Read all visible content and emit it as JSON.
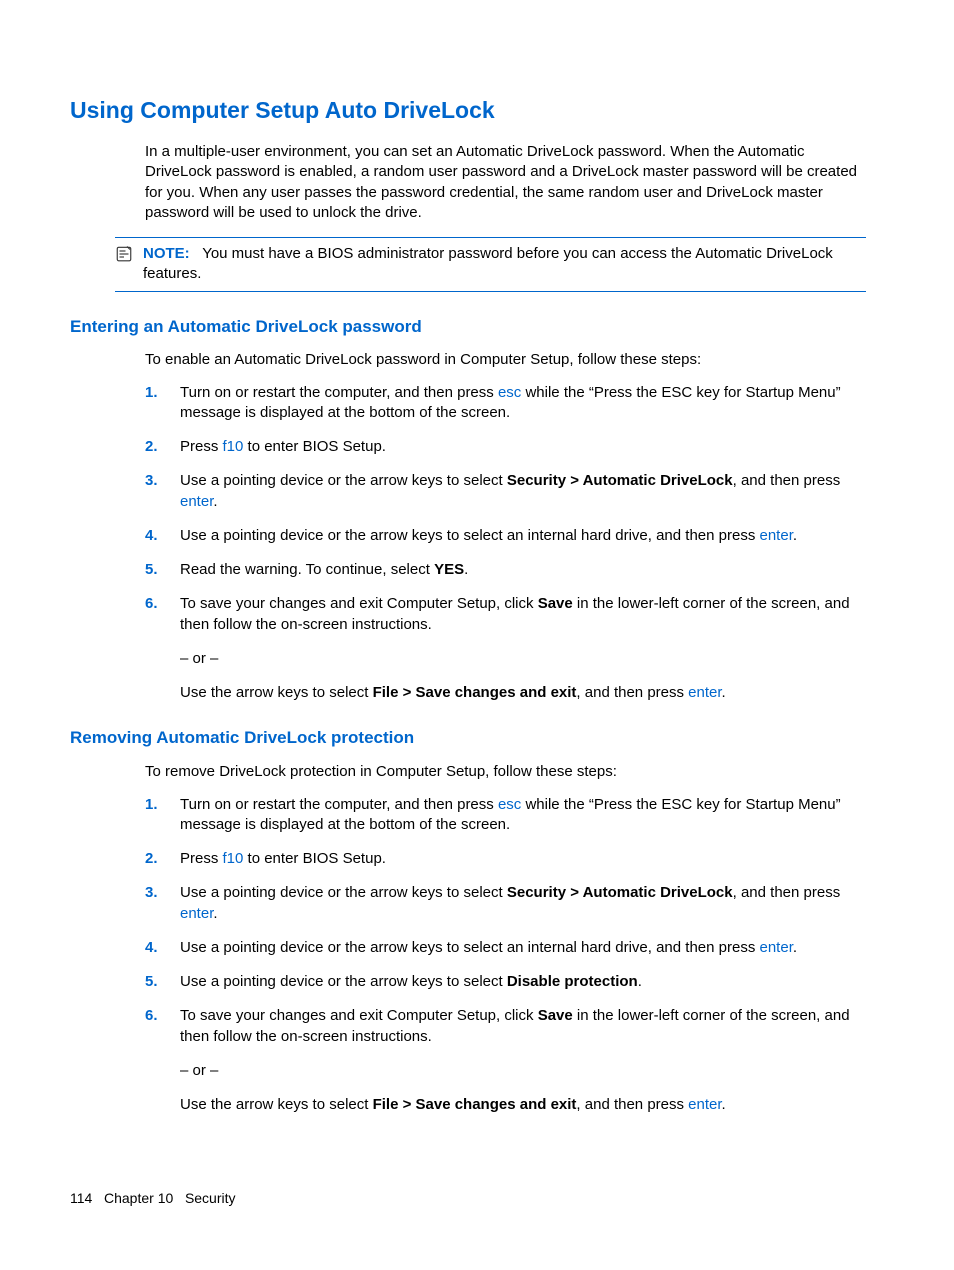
{
  "h1": "Using Computer Setup Auto DriveLock",
  "intro": "In a multiple-user environment, you can set an Automatic DriveLock password. When the Automatic DriveLock password is enabled, a random user password and a DriveLock master password will be created for you. When any user passes the password credential, the same random user and DriveLock master password will be used to unlock the drive.",
  "note": {
    "label": "NOTE:",
    "text": "You must have a BIOS administrator password before you can access the Automatic DriveLock features."
  },
  "sec1": {
    "title": "Entering an Automatic DriveLock password",
    "intro": "To enable an Automatic DriveLock password in Computer Setup, follow these steps:",
    "s1a": "Turn on or restart the computer, and then press ",
    "s1k": "esc",
    "s1b": " while the “Press the ESC key for Startup Menu” message is displayed at the bottom of the screen.",
    "s2a": "Press ",
    "s2k": "f10",
    "s2b": " to enter BIOS Setup.",
    "s3a": "Use a pointing device or the arrow keys to select ",
    "s3bold": "Security > Automatic DriveLock",
    "s3b": ", and then press ",
    "s3k": "enter",
    "s3c": ".",
    "s4a": "Use a pointing device or the arrow keys to select an internal hard drive, and then press ",
    "s4k": "enter",
    "s4b": ".",
    "s5a": "Read the warning. To continue, select ",
    "s5bold": "YES",
    "s5b": ".",
    "s6a": "To save your changes and exit Computer Setup, click ",
    "s6bold": "Save",
    "s6b": " in the lower-left corner of the screen, and then follow the on-screen instructions.",
    "s6or": "– or –",
    "s6c": "Use the arrow keys to select ",
    "s6bold2": "File > Save changes and exit",
    "s6d": ", and then press ",
    "s6k": "enter",
    "s6e": "."
  },
  "sec2": {
    "title": "Removing Automatic DriveLock protection",
    "intro": "To remove DriveLock protection in Computer Setup, follow these steps:",
    "s1a": "Turn on or restart the computer, and then press ",
    "s1k": "esc",
    "s1b": " while the “Press the ESC key for Startup Menu” message is displayed at the bottom of the screen.",
    "s2a": "Press ",
    "s2k": "f10",
    "s2b": " to enter BIOS Setup.",
    "s3a": "Use a pointing device or the arrow keys to select ",
    "s3bold": "Security > Automatic DriveLock",
    "s3b": ", and then press ",
    "s3k": "enter",
    "s3c": ".",
    "s4a": "Use a pointing device or the arrow keys to select an internal hard drive, and then press ",
    "s4k": "enter",
    "s4b": ".",
    "s5a": "Use a pointing device or the arrow keys to select ",
    "s5bold": "Disable protection",
    "s5b": ".",
    "s6a": "To save your changes and exit Computer Setup, click ",
    "s6bold": "Save",
    "s6b": " in the lower-left corner of the screen, and then follow the on-screen instructions.",
    "s6or": "– or –",
    "s6c": "Use the arrow keys to select ",
    "s6bold2": "File > Save changes and exit",
    "s6d": ", and then press ",
    "s6k": "enter",
    "s6e": "."
  },
  "footer": {
    "page": "114",
    "chapter": "Chapter 10   Security"
  }
}
